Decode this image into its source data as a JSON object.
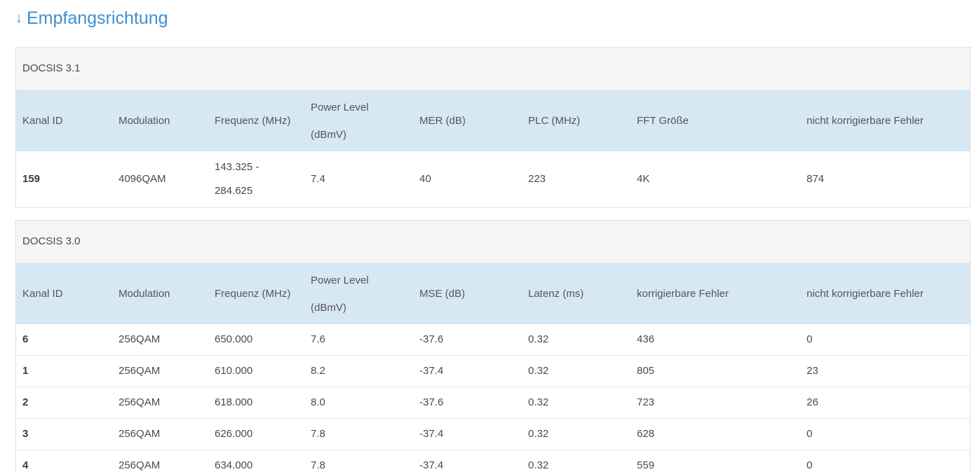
{
  "section": {
    "arrow": "↓",
    "title": "Empfangsrichtung"
  },
  "docsis31": {
    "title": "DOCSIS 3.1",
    "headers": {
      "kanal_id": "Kanal ID",
      "modulation": "Modulation",
      "frequenz": "Frequenz (MHz)",
      "power_line1": "Power Level",
      "power_line2": "(dBmV)",
      "mer": "MER (dB)",
      "plc": "PLC (MHz)",
      "fft": "FFT Größe",
      "nicht_korr": "nicht korrigierbare Fehler"
    },
    "rows": [
      {
        "kanal_id": "159",
        "modulation": "4096QAM",
        "frequenz_line1": "143.325 -",
        "frequenz_line2": "284.625",
        "power": "7.4",
        "mer": "40",
        "plc": "223",
        "fft": "4K",
        "nicht_korr": "874"
      }
    ]
  },
  "docsis30": {
    "title": "DOCSIS 3.0",
    "headers": {
      "kanal_id": "Kanal ID",
      "modulation": "Modulation",
      "frequenz": "Frequenz (MHz)",
      "power_line1": "Power Level",
      "power_line2": "(dBmV)",
      "mse": "MSE (dB)",
      "latenz": "Latenz (ms)",
      "korr": "korrigierbare Fehler",
      "nicht_korr": "nicht korrigierbare Fehler"
    },
    "rows": [
      {
        "kanal_id": "6",
        "modulation": "256QAM",
        "frequenz": "650.000",
        "power": "7.6",
        "mse": "-37.6",
        "latenz": "0.32",
        "korr": "436",
        "nicht_korr": "0"
      },
      {
        "kanal_id": "1",
        "modulation": "256QAM",
        "frequenz": "610.000",
        "power": "8.2",
        "mse": "-37.4",
        "latenz": "0.32",
        "korr": "805",
        "nicht_korr": "23"
      },
      {
        "kanal_id": "2",
        "modulation": "256QAM",
        "frequenz": "618.000",
        "power": "8.0",
        "mse": "-37.6",
        "latenz": "0.32",
        "korr": "723",
        "nicht_korr": "26"
      },
      {
        "kanal_id": "3",
        "modulation": "256QAM",
        "frequenz": "626.000",
        "power": "7.8",
        "mse": "-37.4",
        "latenz": "0.32",
        "korr": "628",
        "nicht_korr": "0"
      },
      {
        "kanal_id": "4",
        "modulation": "256QAM",
        "frequenz": "634.000",
        "power": "7.8",
        "mse": "-37.4",
        "latenz": "0.32",
        "korr": "559",
        "nicht_korr": "0"
      }
    ]
  },
  "colors": {
    "title_blue": "#3f8fd2",
    "header_row_bg": "#d7e8f5",
    "panel_head_bg": "#f5f5f4"
  }
}
